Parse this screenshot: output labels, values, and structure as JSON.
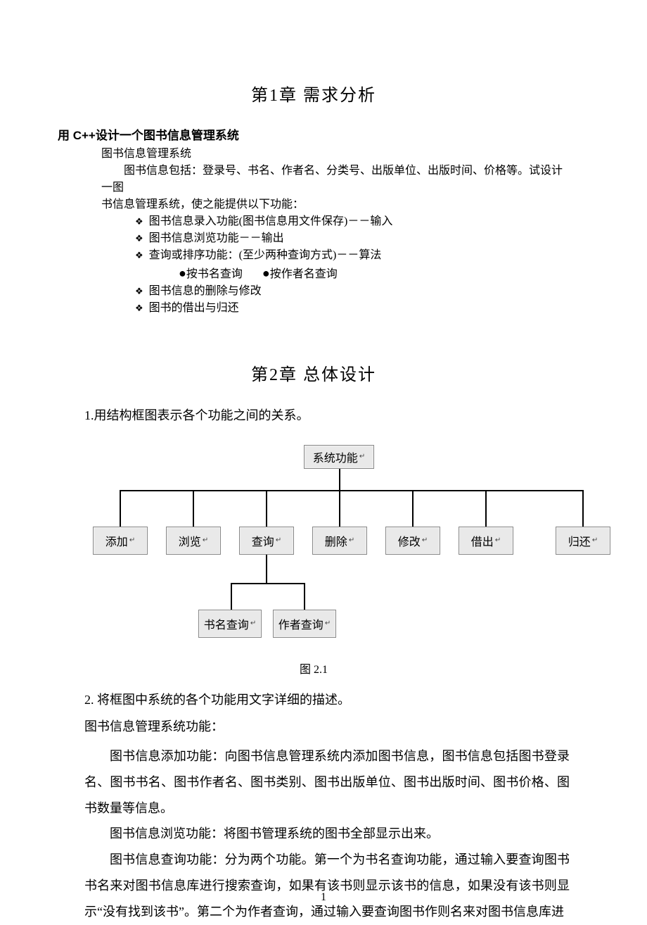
{
  "chapter1": {
    "title": "第1章  需求分析",
    "heading": "用 C++设计一个图书信息管理系统",
    "line1": "图书信息管理系统",
    "line2": "图书信息包括：登录号、书名、作者名、分类号、出版单位、出版时间、价格等。试设计一图",
    "line3": "书信息管理系统，使之能提供以下功能：",
    "bullets": [
      "图书信息录入功能(图书信息用文件保存)－－输入",
      "图书信息浏览功能－－输出",
      "查询或排序功能：(至少两种查询方式)－－算法"
    ],
    "sub_a": "按书名查询",
    "sub_b": "按作者名查询",
    "bullets2": [
      "图书信息的删除与修改",
      "图书的借出与归还"
    ]
  },
  "chapter2": {
    "title": "第2章  总体设计",
    "point1": "1.用结构框图表示各个功能之间的关系。",
    "diagram": {
      "root": "系统功能",
      "level1": [
        "添加",
        "浏览",
        "查询",
        "删除",
        "修改",
        "借出",
        "归还"
      ],
      "level2": [
        "书名查询",
        "作者查询"
      ]
    },
    "caption": "图 2.1",
    "point2": "2. 将框图中系统的各个功能用文字详细的描述。",
    "line_sys": "图书信息管理系统功能：",
    "para1": "图书信息添加功能：向图书信息管理系统内添加图书信息，图书信息包括图书登录名、图书书名、图书作者名、图书类别、图书出版单位、图书出版时间、图书价格、图书数量等信息。",
    "para2": "图书信息浏览功能：将图书管理系统的图书全部显示出来。",
    "para3": "图书信息查询功能：分为两个功能。第一个为书名查询功能，通过输入要查询图书书名来对图书信息库进行搜索查询，如果有该书则显示该书的信息，如果没有该书则显示“没有找到该书”。第二个为作者查询，通过输入要查询图书作则名来对图书信息库进"
  },
  "page_number": "1",
  "chart_data": {
    "type": "tree",
    "title": "系统功能",
    "root": "系统功能",
    "children": [
      {
        "name": "添加"
      },
      {
        "name": "浏览"
      },
      {
        "name": "查询",
        "children": [
          {
            "name": "书名查询"
          },
          {
            "name": "作者查询"
          }
        ]
      },
      {
        "name": "删除"
      },
      {
        "name": "修改"
      },
      {
        "name": "借出"
      },
      {
        "name": "归还"
      }
    ]
  }
}
